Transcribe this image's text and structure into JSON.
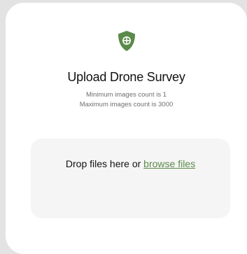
{
  "upload": {
    "title": "Upload Drone Survey",
    "min_text": "Minimum images count is 1",
    "max_text": "Maximum images count is 3000",
    "icon": "shield-icon",
    "accent_color": "#5b8a4a"
  },
  "dropzone": {
    "prompt": "Drop files here or",
    "browse_label": "browse files"
  }
}
